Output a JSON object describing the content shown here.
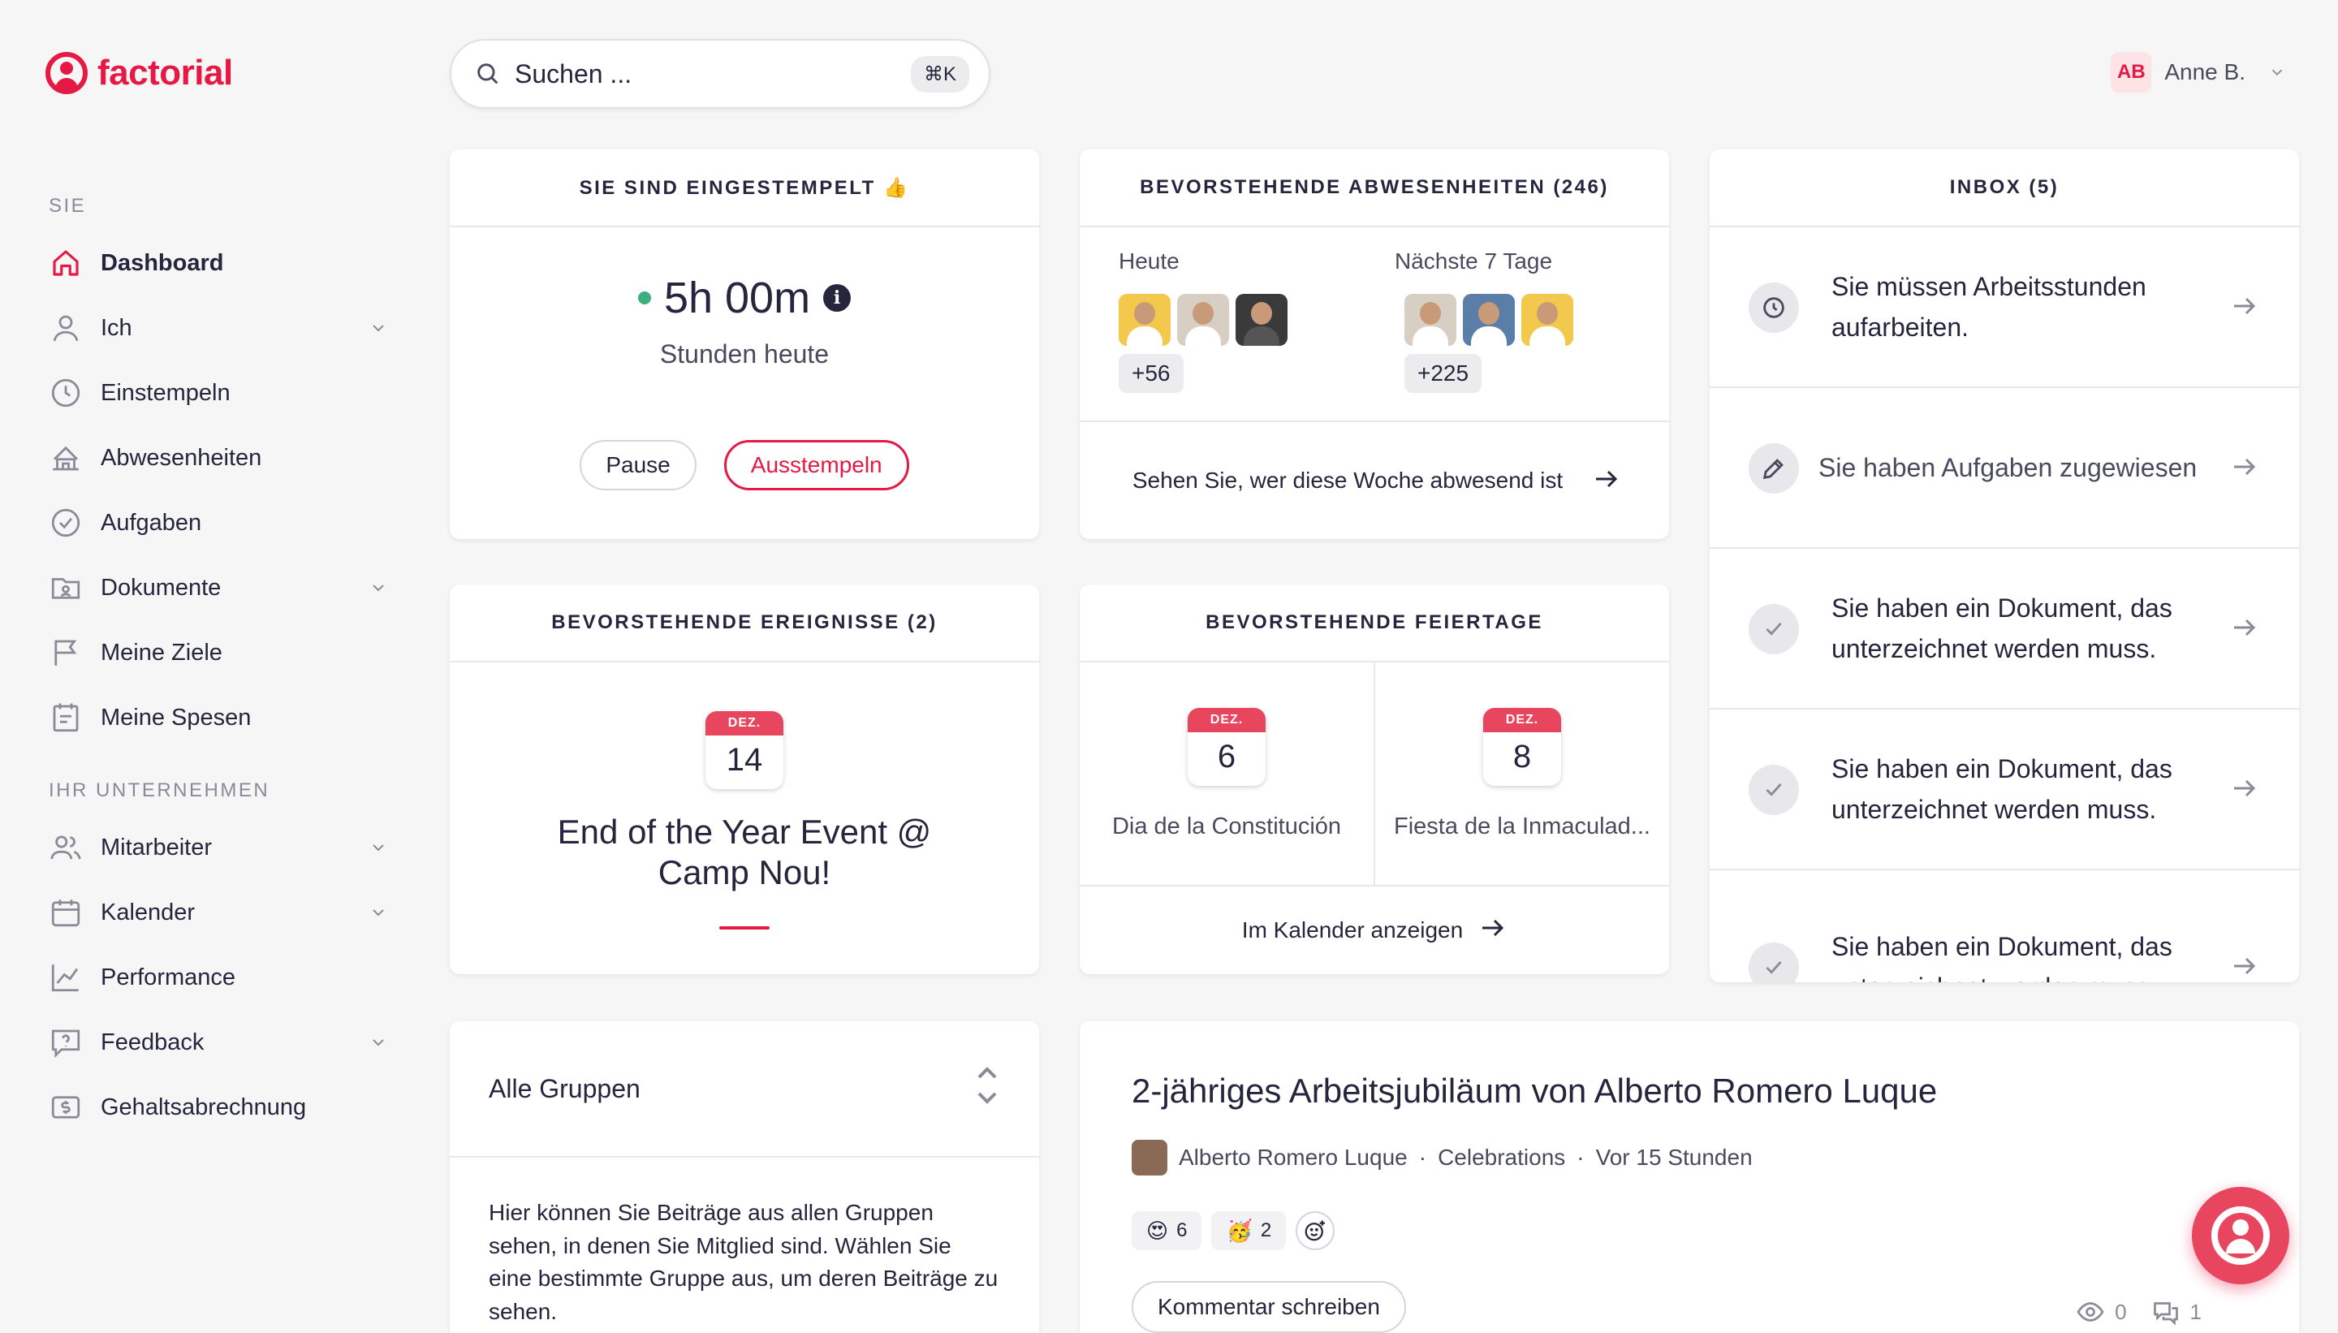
{
  "brand": {
    "name": "factorial",
    "color": "#e51943"
  },
  "search": {
    "placeholder": "Suchen ...",
    "shortcut": "⌘K"
  },
  "user": {
    "initials": "AB",
    "name": "Anne B."
  },
  "sidebar": {
    "section_you": "SIE",
    "section_company": "IHR UNTERNEHMEN",
    "items": [
      {
        "label": "Dashboard",
        "icon": "home-icon",
        "active": true
      },
      {
        "label": "Ich",
        "icon": "person-icon",
        "expandable": true
      },
      {
        "label": "Einstempeln",
        "icon": "clock-icon"
      },
      {
        "label": "Abwesenheiten",
        "icon": "beach-icon"
      },
      {
        "label": "Aufgaben",
        "icon": "check-circle-icon"
      },
      {
        "label": "Dokumente",
        "icon": "folder-icon",
        "expandable": true
      },
      {
        "label": "Meine Ziele",
        "icon": "flag-icon"
      },
      {
        "label": "Meine Spesen",
        "icon": "receipt-icon"
      }
    ],
    "company_items": [
      {
        "label": "Mitarbeiter",
        "icon": "people-icon",
        "expandable": true
      },
      {
        "label": "Kalender",
        "icon": "calendar-icon",
        "expandable": true
      },
      {
        "label": "Performance",
        "icon": "chart-icon"
      },
      {
        "label": "Feedback",
        "icon": "feedback-icon",
        "expandable": true
      },
      {
        "label": "Gehaltsabrechnung",
        "icon": "payroll-icon"
      }
    ]
  },
  "clock_card": {
    "title": "SIE SIND EINGESTEMPELT 👍",
    "time": "5h 00m",
    "subtitle": "Stunden heute",
    "pause_label": "Pause",
    "clockout_label": "Ausstempeln"
  },
  "absences_card": {
    "title": "BEVORSTEHENDE ABWESENHEITEN (246)",
    "today_label": "Heute",
    "today_more": "+56",
    "week_label": "Nächste 7 Tage",
    "week_more": "+225",
    "footer": "Sehen Sie, wer diese Woche abwesend ist"
  },
  "inbox_card": {
    "title": "INBOX (5)",
    "items": [
      {
        "icon": "clock-icon",
        "text": "Sie müssen Arbeitsstunden aufarbeiten."
      },
      {
        "icon": "pencil-icon",
        "text": "Sie haben Aufgaben zugewiesen"
      },
      {
        "icon": "check-icon",
        "text": "Sie haben ein Dokument, das unterzeichnet werden muss."
      },
      {
        "icon": "check-icon",
        "text": "Sie haben ein Dokument, das unterzeichnet werden muss."
      },
      {
        "icon": "check-icon",
        "text": "Sie haben ein Dokument, das unterzeichnet werden muss."
      }
    ]
  },
  "events_card": {
    "title": "BEVORSTEHENDE EREIGNISSE (2)",
    "month": "DEZ.",
    "day": "14",
    "event": "End of the Year Event @ Camp Nou!"
  },
  "holidays_card": {
    "title": "BEVORSTEHENDE FEIERTAGE",
    "holidays": [
      {
        "month": "DEZ.",
        "day": "6",
        "name": "Dia de la Constitución"
      },
      {
        "month": "DEZ.",
        "day": "8",
        "name": "Fiesta de la Inmaculad..."
      }
    ],
    "footer": "Im Kalender anzeigen"
  },
  "groups_card": {
    "title": "Alle Gruppen",
    "description": "Hier können Sie Beiträge aus allen Gruppen sehen, in denen Sie Mitglied sind. Wählen Sie eine bestimmte Gruppe aus, um deren Beiträge zu sehen."
  },
  "post": {
    "title": "2-jähriges Arbeitsjubiläum von Alberto Romero Luque",
    "author": "Alberto Romero Luque",
    "group": "Celebrations",
    "time": "Vor 15 Stunden",
    "reactions": [
      {
        "emoji": "😍",
        "count": "6"
      },
      {
        "emoji": "🥳",
        "count": "2"
      }
    ],
    "comment_label": "Kommentar schreiben",
    "views": "0",
    "comments": "1"
  }
}
